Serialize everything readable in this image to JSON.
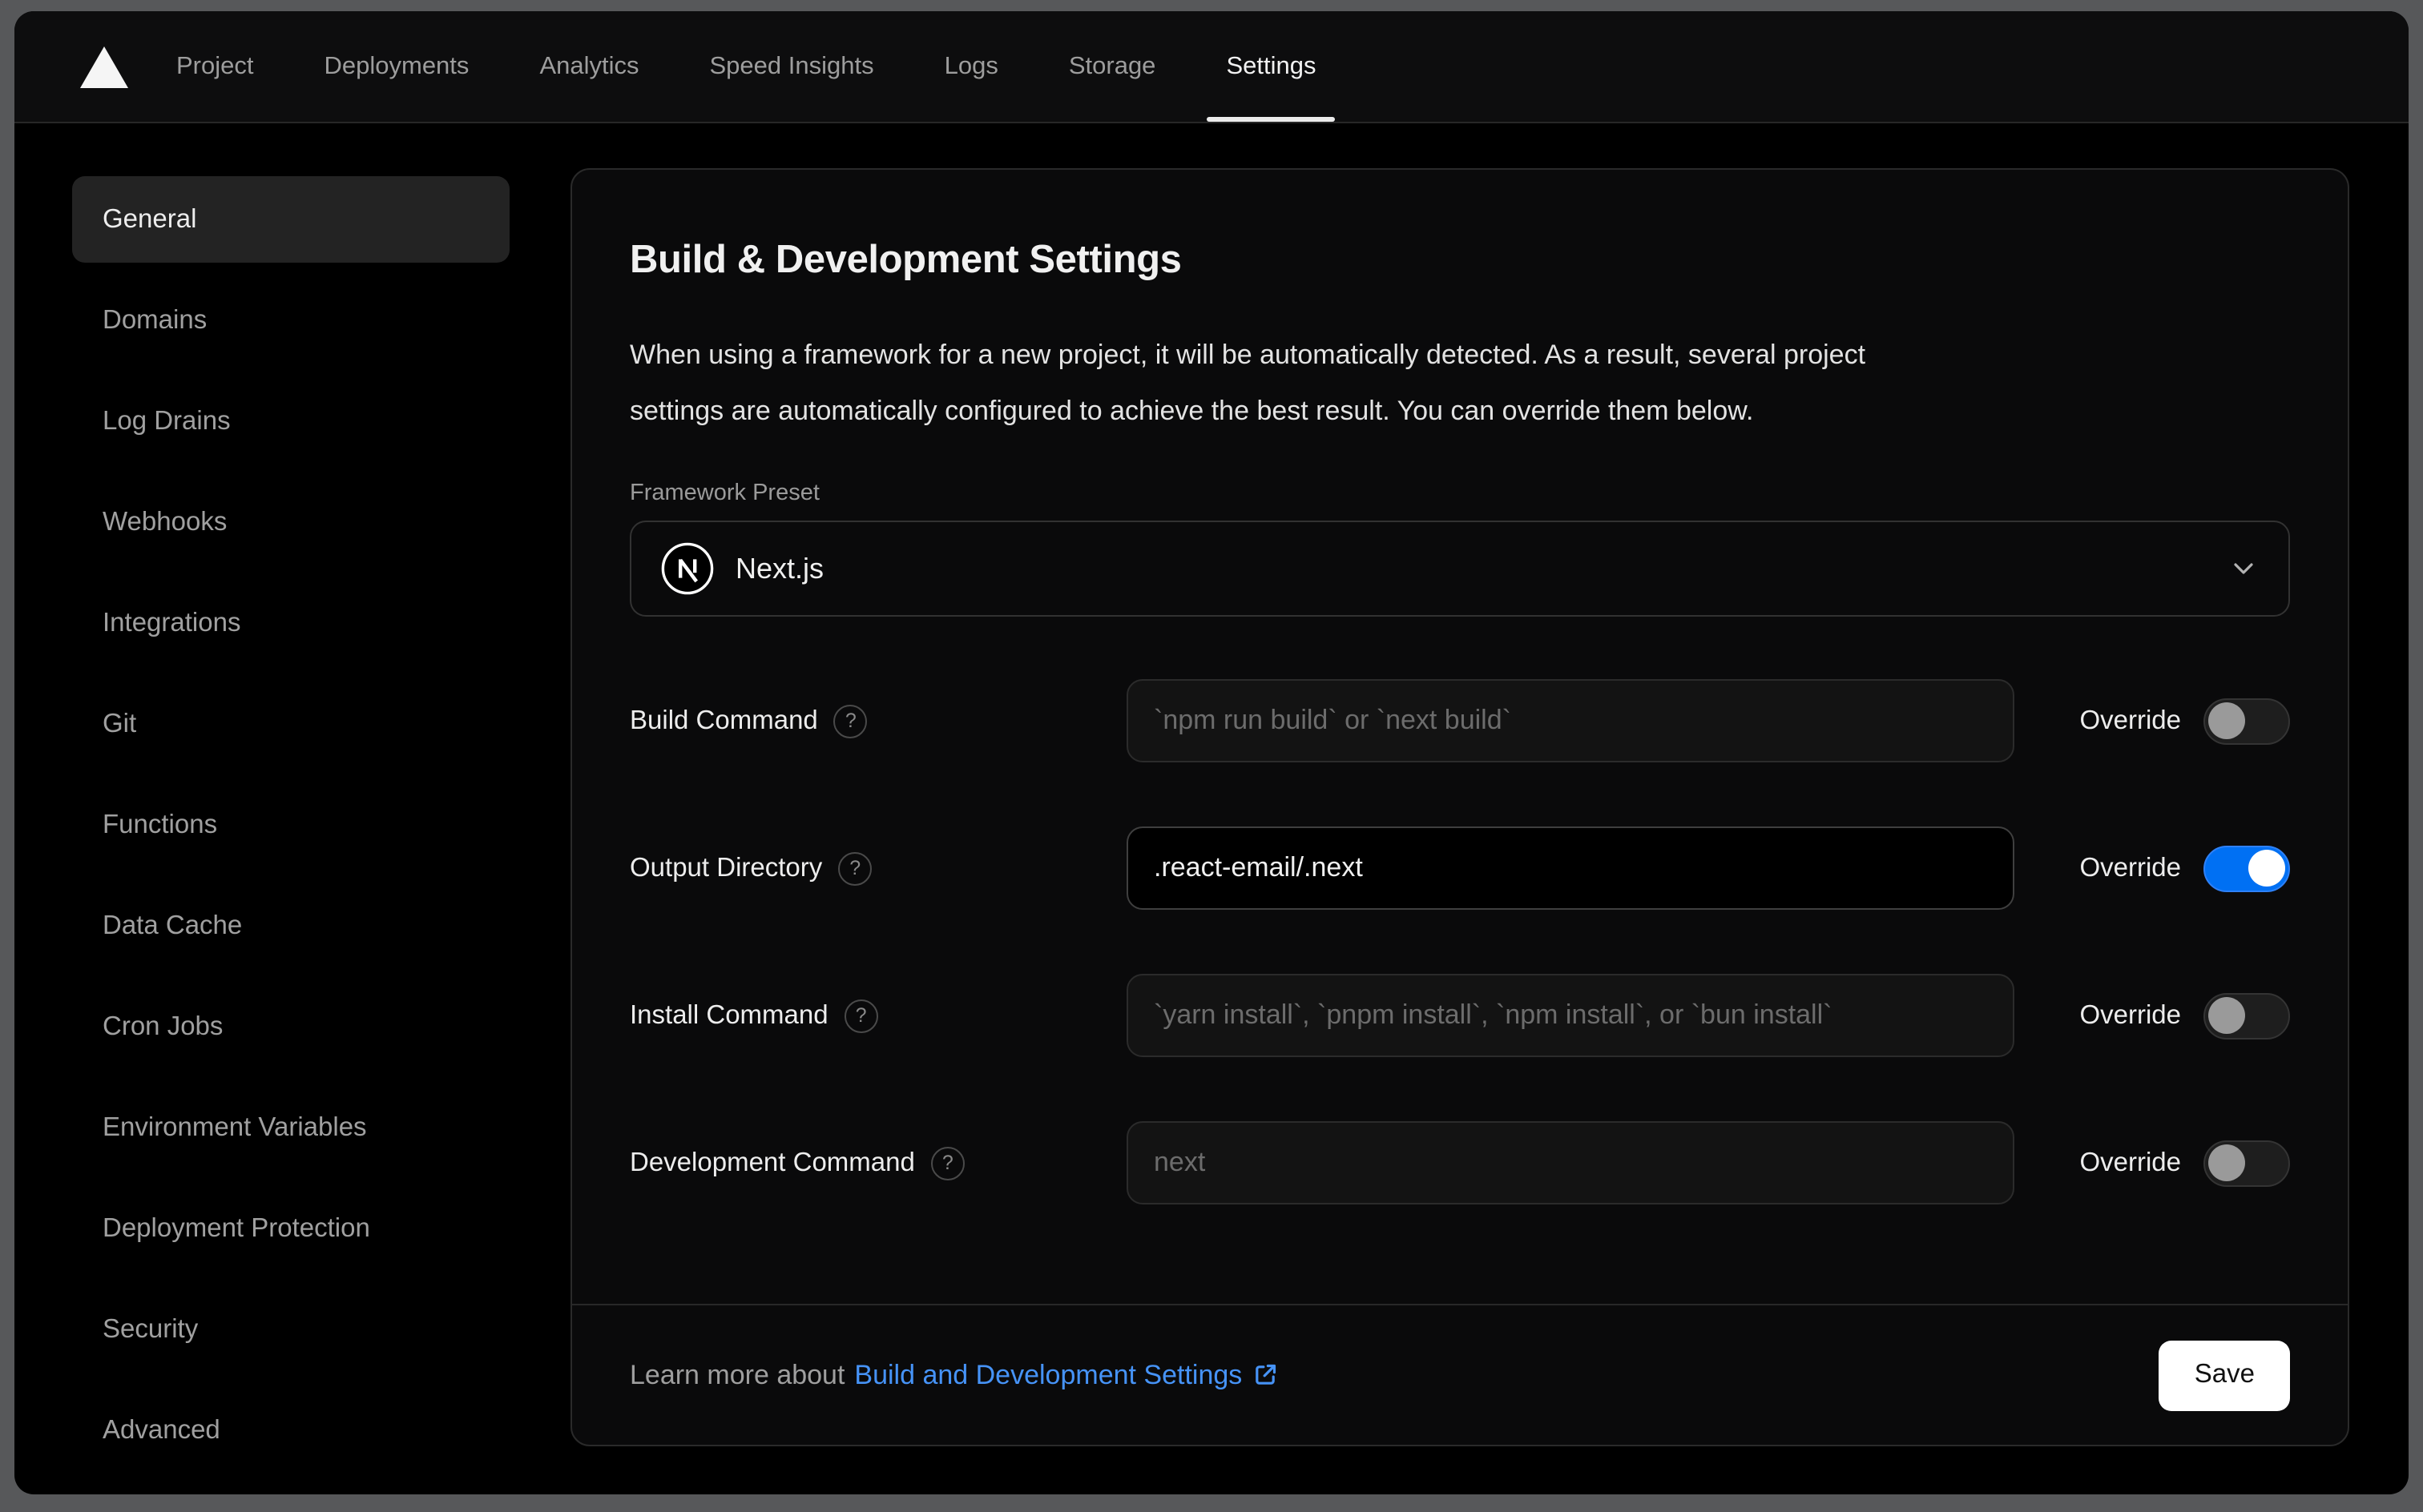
{
  "window": {
    "frame_color": "#57585a"
  },
  "nav": {
    "logo_icon": "vercel-triangle-logo",
    "tabs": [
      {
        "label": "Project",
        "active": false
      },
      {
        "label": "Deployments",
        "active": false
      },
      {
        "label": "Analytics",
        "active": false
      },
      {
        "label": "Speed Insights",
        "active": false
      },
      {
        "label": "Logs",
        "active": false
      },
      {
        "label": "Storage",
        "active": false
      },
      {
        "label": "Settings",
        "active": true
      }
    ]
  },
  "sidebar": {
    "items": [
      {
        "label": "General",
        "active": true
      },
      {
        "label": "Domains",
        "active": false
      },
      {
        "label": "Log Drains",
        "active": false
      },
      {
        "label": "Webhooks",
        "active": false
      },
      {
        "label": "Integrations",
        "active": false
      },
      {
        "label": "Git",
        "active": false
      },
      {
        "label": "Functions",
        "active": false
      },
      {
        "label": "Data Cache",
        "active": false
      },
      {
        "label": "Cron Jobs",
        "active": false
      },
      {
        "label": "Environment Variables",
        "active": false
      },
      {
        "label": "Deployment Protection",
        "active": false
      },
      {
        "label": "Security",
        "active": false
      },
      {
        "label": "Advanced",
        "active": false
      }
    ]
  },
  "panel": {
    "title": "Build & Development Settings",
    "description_lines": [
      "When using a framework for a new project, it will be automatically detected. As a result, several project",
      "settings are automatically configured to achieve the best result. You can override them below."
    ],
    "framework": {
      "label": "Framework Preset",
      "value": "Next.js",
      "icon": "nextjs-logo",
      "chevron_icon": "chevron-down-icon"
    },
    "rows": [
      {
        "label": "Build Command",
        "help_icon": "question-mark-icon",
        "placeholder": "`npm run build` or `next build`",
        "value": "",
        "override_label": "Override",
        "override_on": false
      },
      {
        "label": "Output Directory",
        "help_icon": "question-mark-icon",
        "placeholder": "",
        "value": ".react-email/.next",
        "override_label": "Override",
        "override_on": true
      },
      {
        "label": "Install Command",
        "help_icon": "question-mark-icon",
        "placeholder": "`yarn install`, `pnpm install`, `npm install`, or `bun install`",
        "value": "",
        "override_label": "Override",
        "override_on": false
      },
      {
        "label": "Development Command",
        "help_icon": "question-mark-icon",
        "placeholder": "next",
        "value": "",
        "override_label": "Override",
        "override_on": false
      }
    ],
    "footer": {
      "text": "Learn more about",
      "link_label": "Build and Development Settings",
      "link_icon": "external-link-icon",
      "save_label": "Save"
    }
  },
  "colors": {
    "accent_blue": "#0070f3",
    "link_blue": "#4693f7",
    "toggle_off_knob": "#9a9a9a",
    "save_button_bg": "#ffffff",
    "active_tab_underline": "#ebebeb",
    "card_bg": "#0a0a0b",
    "nav_bg": "#0d0d0e"
  }
}
